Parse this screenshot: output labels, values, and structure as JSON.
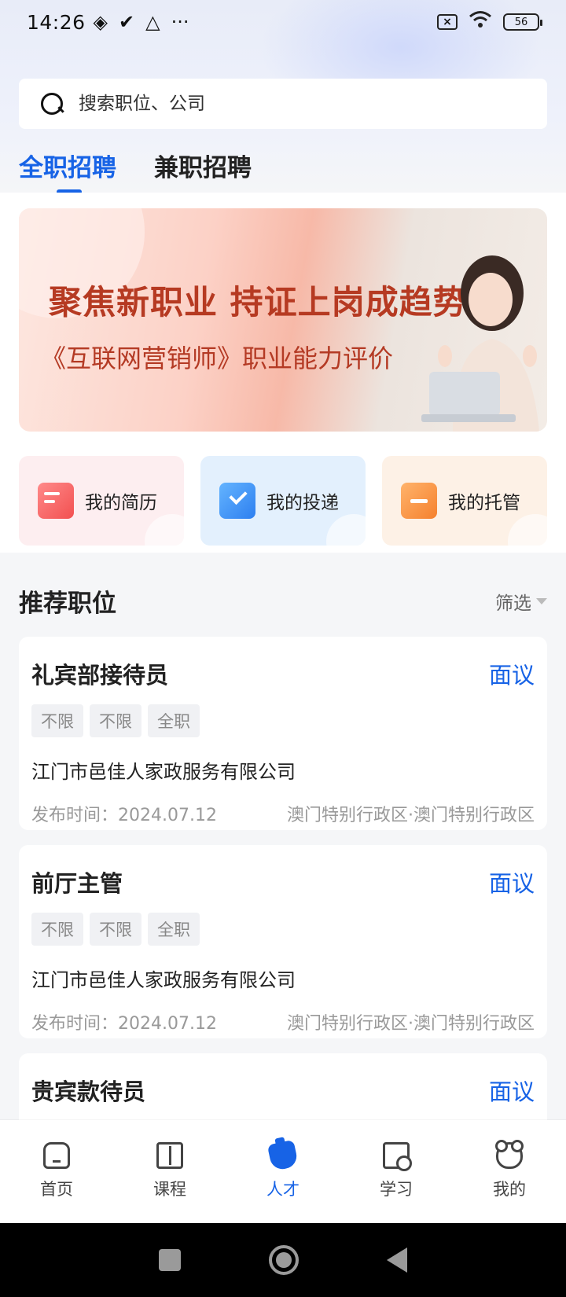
{
  "status_bar": {
    "time": "14:26",
    "battery": "56"
  },
  "search": {
    "placeholder": "搜索职位、公司"
  },
  "tabs": [
    {
      "label": "全职招聘",
      "active": true
    },
    {
      "label": "兼职招聘",
      "active": false
    }
  ],
  "banner": {
    "title": "聚焦新职业 持证上岗成趋势",
    "subtitle": "《互联网营销师》职业能力评价"
  },
  "quick_actions": [
    {
      "label": "我的简历",
      "icon": "resume-icon"
    },
    {
      "label": "我的投递",
      "icon": "send-icon"
    },
    {
      "label": "我的托管",
      "icon": "trust-icon"
    }
  ],
  "section": {
    "title": "推荐职位",
    "filter_label": "筛选"
  },
  "jobs": [
    {
      "title": "礼宾部接待员",
      "salary": "面议",
      "tags": [
        "不限",
        "不限",
        "全职"
      ],
      "company": "江门市邑佳人家政服务有限公司",
      "date": "发布时间：2024.07.12",
      "location": "澳门特别行政区·澳门特别行政区"
    },
    {
      "title": "前厅主管",
      "salary": "面议",
      "tags": [
        "不限",
        "不限",
        "全职"
      ],
      "company": "江门市邑佳人家政服务有限公司",
      "date": "发布时间：2024.07.12",
      "location": "澳门特别行政区·澳门特别行政区"
    },
    {
      "title": "贵宾款待员",
      "salary": "面议",
      "tags": [
        "",
        "",
        ""
      ],
      "company": "",
      "date": "",
      "location": ""
    }
  ],
  "bottom_nav": [
    {
      "label": "首页",
      "icon": "home-icon"
    },
    {
      "label": "课程",
      "icon": "course-icon"
    },
    {
      "label": "人才",
      "icon": "talent-icon",
      "active": true
    },
    {
      "label": "学习",
      "icon": "study-icon"
    },
    {
      "label": "我的",
      "icon": "mine-icon"
    }
  ],
  "colors": {
    "accent": "#1763e6",
    "banner_text": "#b63a22"
  }
}
